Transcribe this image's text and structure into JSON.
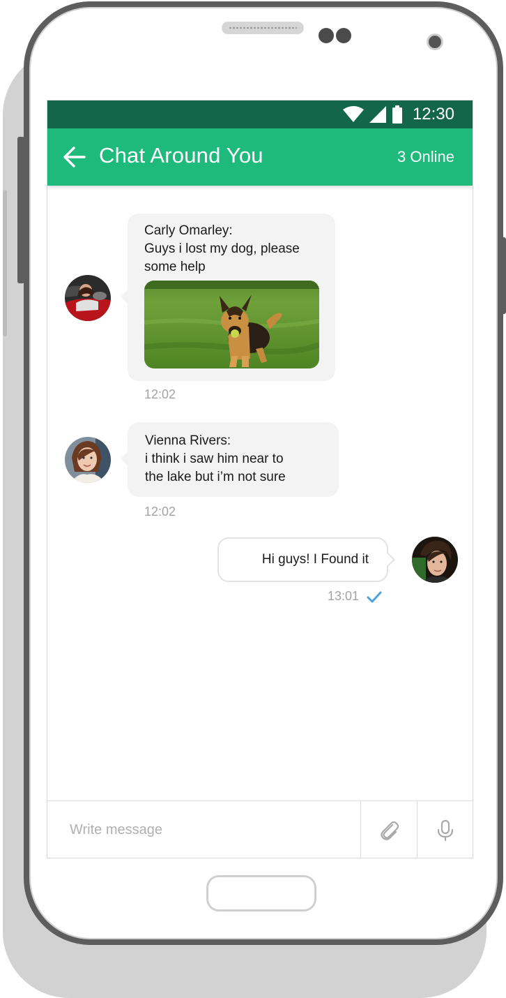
{
  "status_bar": {
    "time": "12:30"
  },
  "app_bar": {
    "title": "Chat Around You",
    "online": "3 Online"
  },
  "messages": [
    {
      "lines": [
        "Carly Omarley:",
        "Guys i lost my dog, please",
        "some help"
      ],
      "time": "12:02",
      "has_image": true
    },
    {
      "lines": [
        "Vienna Rivers:",
        "i think i saw him near to",
        "the lake but i’m not sure"
      ],
      "time": "12:02"
    },
    {
      "lines": [
        "Hi guys! I Found it"
      ],
      "time": "13:01",
      "status": "read"
    }
  ],
  "composer": {
    "placeholder": "Write message"
  },
  "colors": {
    "status_bar": "#13664a",
    "app_bar": "#1eba7c",
    "check": "#4aa3df"
  }
}
